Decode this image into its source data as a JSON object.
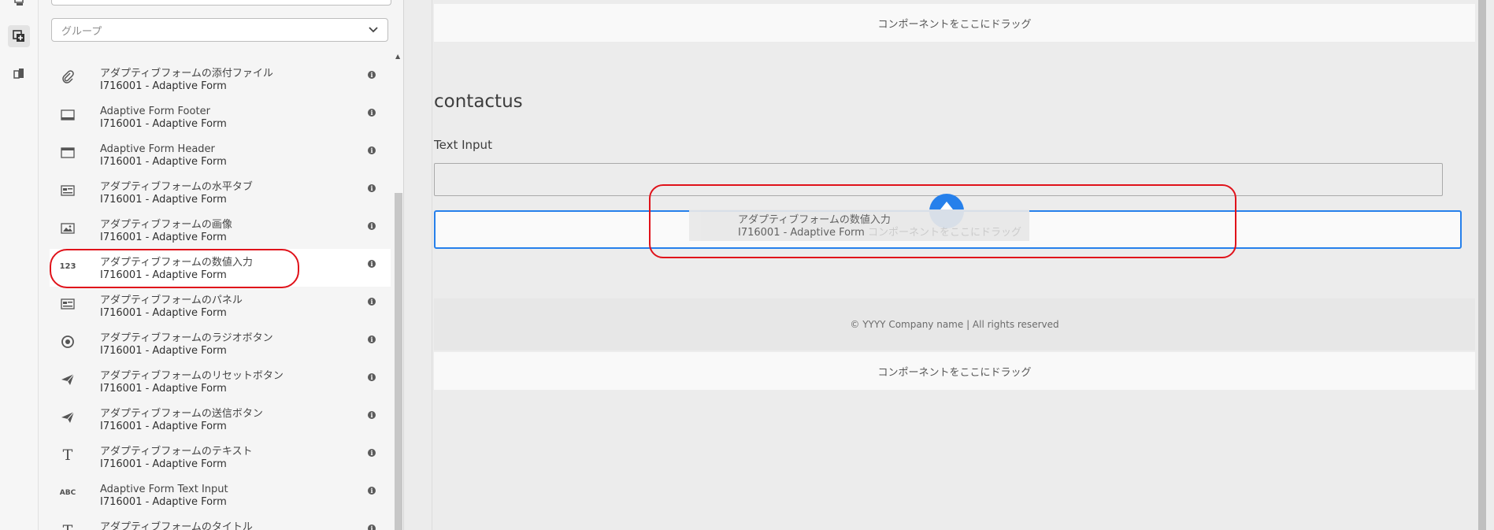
{
  "rail": {
    "icons": [
      "layers-icon",
      "add-component-icon",
      "assets-icon"
    ]
  },
  "panel": {
    "group_placeholder": "グループ",
    "items": [
      {
        "icon": "paperclip-icon",
        "title": "アダプティブフォームの添付ファイル",
        "subtitle": "I716001 - Adaptive Form"
      },
      {
        "icon": "footer-icon",
        "title": "Adaptive Form Footer",
        "subtitle": "I716001 - Adaptive Form"
      },
      {
        "icon": "header-icon",
        "title": "Adaptive Form Header",
        "subtitle": "I716001 - Adaptive Form"
      },
      {
        "icon": "horizontal-tabs-icon",
        "title": "アダプティブフォームの水平タブ",
        "subtitle": "I716001 - Adaptive Form"
      },
      {
        "icon": "image-icon",
        "title": "アダプティブフォームの画像",
        "subtitle": "I716001 - Adaptive Form"
      },
      {
        "icon": "numeric-input-icon",
        "icon_text": "123",
        "title": "アダプティブフォームの数値入力",
        "subtitle": "I716001 - Adaptive Form"
      },
      {
        "icon": "panel-icon",
        "title": "アダプティブフォームのパネル",
        "subtitle": "I716001 - Adaptive Form"
      },
      {
        "icon": "radio-button-icon",
        "title": "アダプティブフォームのラジオボタン",
        "subtitle": "I716001 - Adaptive Form"
      },
      {
        "icon": "send-icon",
        "title": "アダプティブフォームのリセットボタン",
        "subtitle": "I716001 - Adaptive Form"
      },
      {
        "icon": "send-icon",
        "title": "アダプティブフォームの送信ボタン",
        "subtitle": "I716001 - Adaptive Form"
      },
      {
        "icon": "text-icon",
        "icon_text": "T",
        "title": "アダプティブフォームのテキスト",
        "subtitle": "I716001 - Adaptive Form"
      },
      {
        "icon": "text-input-icon",
        "icon_text": "ABC",
        "title": "Adaptive Form Text Input",
        "subtitle": "I716001 - Adaptive Form"
      },
      {
        "icon": "title-icon",
        "icon_text": "T",
        "title": "アダプティブフォームのタイトル",
        "subtitle": ""
      }
    ]
  },
  "canvas": {
    "drop_zone_text": "コンポーネントをここにドラッグ",
    "form_title": "contactus",
    "field_label": "Text Input",
    "footer_text": "© YYYY Company name | All rights reserved"
  },
  "ghost": {
    "title": "アダプティブフォームの数値入力",
    "subtitle": "I716001 - Adaptive Form",
    "drop_text": "コンポーネントをここにドラッグ"
  },
  "colors": {
    "accent": "#2680eb",
    "highlight": "#e0121a"
  }
}
